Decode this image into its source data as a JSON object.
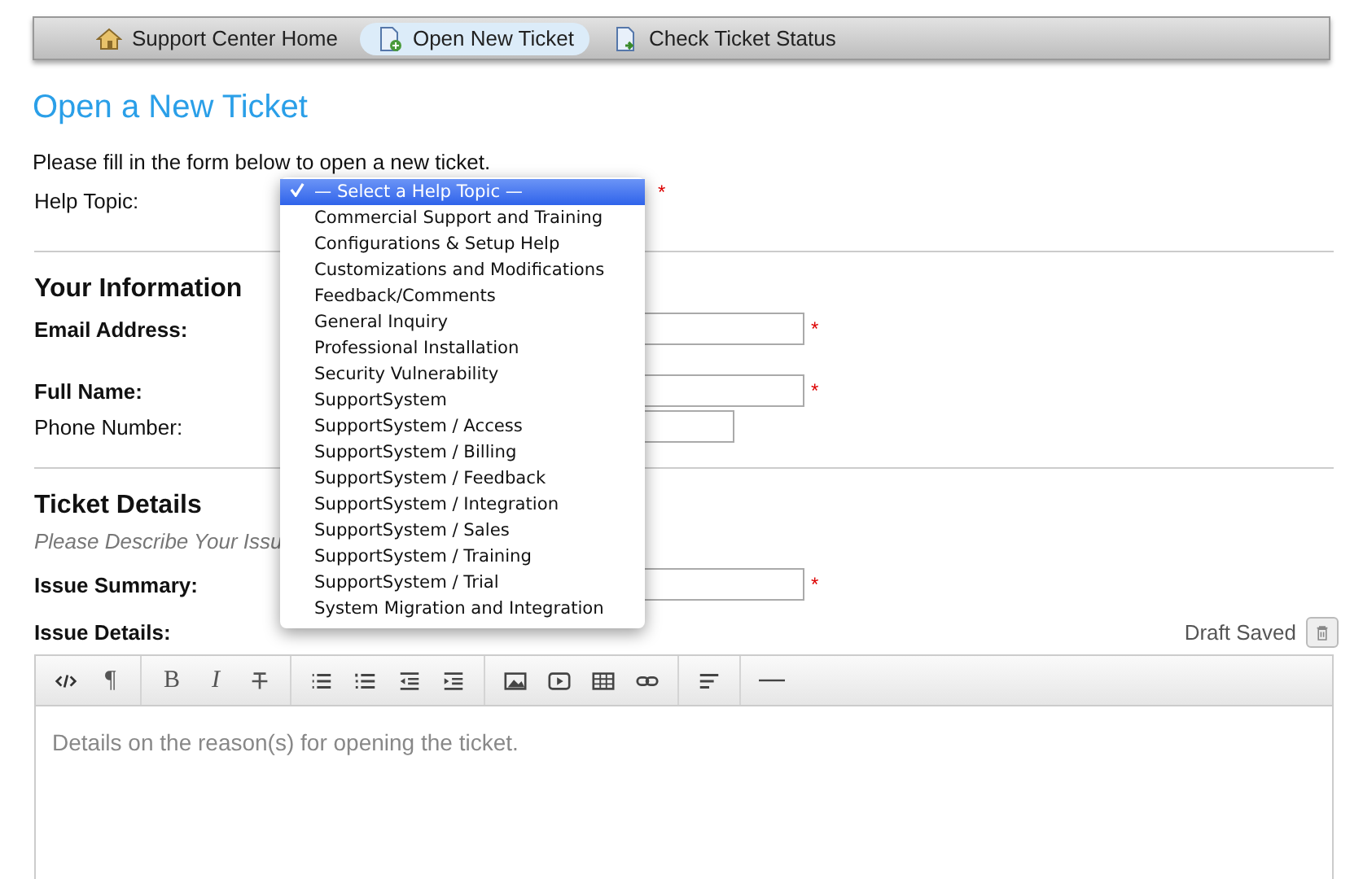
{
  "nav": [
    {
      "label": "Support Center Home",
      "kind": "home",
      "selected": false
    },
    {
      "label": "Open New Ticket",
      "kind": "new",
      "selected": true
    },
    {
      "label": "Check Ticket Status",
      "kind": "status",
      "selected": false
    }
  ],
  "title": "Open a New Ticket",
  "intro": "Please fill in the form below to open a new ticket.",
  "help_topic": {
    "label": "Help Topic:",
    "required_mark": "*",
    "options": [
      {
        "label": "— Select a Help Topic —",
        "selected": true
      },
      {
        "label": "Commercial Support and Training",
        "selected": false
      },
      {
        "label": "Configurations & Setup Help",
        "selected": false
      },
      {
        "label": "Customizations and Modifications",
        "selected": false
      },
      {
        "label": "Feedback/Comments",
        "selected": false
      },
      {
        "label": "General Inquiry",
        "selected": false
      },
      {
        "label": "Professional Installation",
        "selected": false
      },
      {
        "label": "Security Vulnerability",
        "selected": false
      },
      {
        "label": "SupportSystem",
        "selected": false
      },
      {
        "label": "SupportSystem / Access",
        "selected": false
      },
      {
        "label": "SupportSystem / Billing",
        "selected": false
      },
      {
        "label": "SupportSystem / Feedback",
        "selected": false
      },
      {
        "label": "SupportSystem / Integration",
        "selected": false
      },
      {
        "label": "SupportSystem / Sales",
        "selected": false
      },
      {
        "label": "SupportSystem / Training",
        "selected": false
      },
      {
        "label": "SupportSystem / Trial",
        "selected": false
      },
      {
        "label": "System Migration and Integration",
        "selected": false
      }
    ]
  },
  "your_information": {
    "heading": "Your Information",
    "fields": [
      {
        "label": "Email Address:",
        "bold": true,
        "required_mark": "*",
        "kind": "long"
      },
      {
        "label": "Full Name:",
        "bold": true,
        "required_mark": "*",
        "kind": "long"
      },
      {
        "label": "Phone Number:",
        "bold": false,
        "kind": "short"
      }
    ]
  },
  "ticket_details": {
    "heading": "Ticket Details",
    "subheading": "Please Describe Your Issu",
    "summary": {
      "label": "Issue Summary:",
      "required_mark": "*"
    },
    "details_label": "Issue Details:",
    "draft_status": "Draft Saved",
    "toolbar": [
      [
        {
          "kind": "html"
        },
        {
          "kind": "glyph",
          "label": "¶"
        }
      ],
      [
        {
          "kind": "glyph",
          "label": "B"
        },
        {
          "kind": "glyph",
          "label": "I"
        },
        {
          "kind": "strike"
        }
      ],
      [
        {
          "kind": "ul"
        },
        {
          "kind": "ol"
        },
        {
          "kind": "outdent"
        },
        {
          "kind": "indent"
        }
      ],
      [
        {
          "kind": "image"
        },
        {
          "kind": "video"
        },
        {
          "kind": "table"
        },
        {
          "kind": "link"
        }
      ],
      [
        {
          "kind": "align"
        }
      ],
      [
        {
          "kind": "rule"
        }
      ]
    ],
    "editor_placeholder": "Details on the reason(s) for opening the ticket."
  }
}
